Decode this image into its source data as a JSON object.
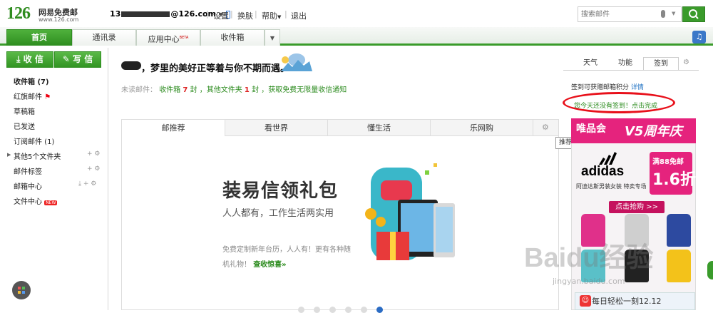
{
  "header": {
    "logo_number": "126",
    "logo_name": "网易免费邮",
    "logo_url": "www.126.com",
    "account_prefix": "13",
    "account_suffix": "@126.com",
    "nav": [
      "设置",
      "换肤",
      "帮助",
      "退出"
    ],
    "search_placeholder": "搜索邮件"
  },
  "tabs": [
    "首页",
    "通讯录",
    "应用中心",
    "收件箱"
  ],
  "tab_badge": "BETA",
  "sidebar": {
    "receive_label": "收 信",
    "write_label": "写 信",
    "folders": [
      "收件箱 (7)",
      "红旗邮件",
      "草稿箱",
      "已发送",
      "订阅邮件 (1)",
      "其他5个文件夹",
      "邮件标签",
      "邮箱中心",
      "文件中心"
    ],
    "new_badge": "NEW"
  },
  "main": {
    "greeting": "，梦里的美好正等着与你不期而遇。",
    "unread_label": "未读邮件：",
    "inbox_text": "收件箱",
    "inbox_count": "7",
    "unit1": "封",
    "others_text": "，其他文件夹",
    "others_count": "1",
    "unit2": "封",
    "promo_notify": "，获取免费无限量收信通知",
    "content_tabs": [
      "邮推荐",
      "看世界",
      "懂生活",
      "乐网购"
    ],
    "settings_tooltip": "推荐功能设置",
    "promo_title": "装易信领礼包",
    "promo_subtitle": "人人都有，工作生活两实用",
    "promo_desc": "免费定制新年台历，人人有！更有各种随机礼物！",
    "promo_link": "查收惊喜»"
  },
  "right": {
    "tabs": [
      "天气",
      "功能",
      "签到"
    ],
    "checkin_tip": "签到可获赠邮箱积分",
    "checkin_detail": "详情",
    "checkin_link": "您今天还没有签到！点击完成",
    "ad_brand": "唯品会",
    "ad_anniversary": "V5周年庆",
    "ad_adidas": "adidas",
    "ad_adidas_sub": "阿迪达斯男装女装 特卖专场",
    "ad_badge_top": "满88免邮",
    "ad_badge_big": "1.6折",
    "ad_buy": "点击抢购 >>",
    "daily": "每日轻松一刻12.12"
  },
  "watermark": "Baidu经验",
  "watermark_url": "jingyan.baidu.com",
  "colors": {
    "brand_green": "#3a9b2b",
    "highlight_red": "#e8101a",
    "ad_pink": "#e5237d"
  }
}
